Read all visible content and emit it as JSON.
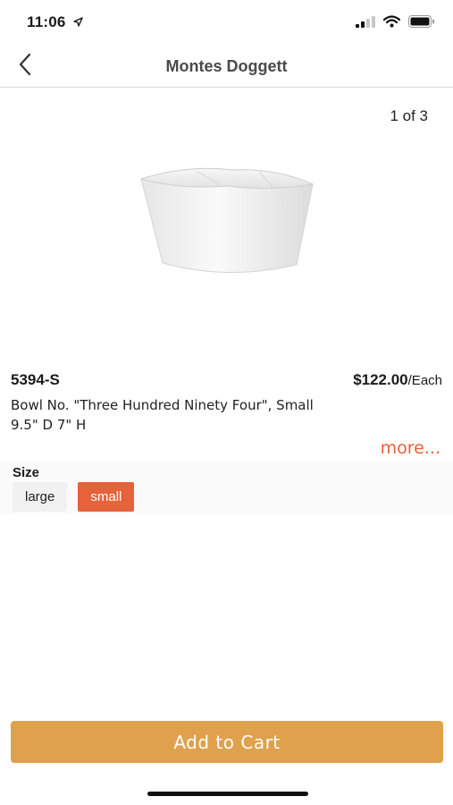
{
  "status_bar": {
    "time": "11:06",
    "location_icon": "location-arrow-icon",
    "signal_icon": "cellular-signal-icon",
    "wifi_icon": "wifi-icon",
    "battery_icon": "battery-icon"
  },
  "nav": {
    "back_icon": "chevron-left-icon",
    "title": "Montes Doggett"
  },
  "gallery": {
    "counter": "1 of 3"
  },
  "product": {
    "sku": "5394-S",
    "price": "$122.00",
    "price_unit": "/Each",
    "name": "Bowl No. \"Three Hundred Ninety Four\", Small",
    "dimensions": "9.5\" D 7\" H",
    "more_label": "more..."
  },
  "size": {
    "label": "Size",
    "options": [
      "large",
      "small"
    ],
    "selected": "small"
  },
  "cart": {
    "button_label": "Add to Cart"
  },
  "colors": {
    "accent": "#e5623a",
    "cart_button": "#e0a14c",
    "title_gray": "#4a4a4a"
  }
}
